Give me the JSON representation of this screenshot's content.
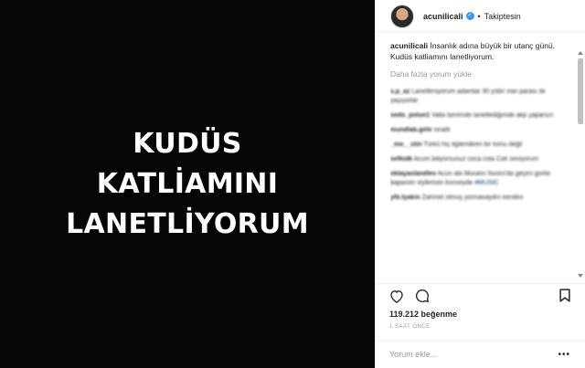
{
  "post": {
    "headline": [
      "KUDÜS",
      "KATLİAMINI",
      "LANETLİYORUM"
    ]
  },
  "header": {
    "username": "acunilicali",
    "separator": "•",
    "follow_label": "Takiptesin"
  },
  "caption": {
    "username": "acunilicali",
    "text": "İnsanlık adına büyük bir utanç günü. Kudüs katliamını lanetliyorum."
  },
  "load_more_label": "Daha fazla yorum yükle",
  "comments": [
    {
      "user": "s.p_az",
      "text": "Lanetleniyorum adamlar 30 yıldır ıran parası ile yaşıyorlar"
    },
    {
      "user": "sedo_polun1",
      "text": "Valla benimde lanetlediğimde akp yaparsın"
    },
    {
      "user": "mundlab.gelir",
      "text": "israilli"
    },
    {
      "user": "_mo__stin",
      "text": "Türkü hiç ilgilendiren bir konu değil"
    },
    {
      "user": "sefkidk",
      "text": "Acum biliyorsunuz coca cola Cok seviyorum"
    },
    {
      "user": "oktayaslandlev",
      "text": "Acun abi Muratın Itunes'da geçen gorito baparoin stylemsin konseyde",
      "tag": "#MUSIC"
    },
    {
      "user": "yfb.tyakin",
      "text": "Zahmet olmuş yormasaydın kendini"
    }
  ],
  "actions": {
    "likes": "119.212 beğenme",
    "time": "1 SAAT ÖNCE"
  },
  "comment_input": {
    "placeholder": "Yorum ekle..."
  },
  "more_glyph": "•••",
  "colors": {
    "accent": "#3897f0",
    "image_bg": "#050505"
  }
}
